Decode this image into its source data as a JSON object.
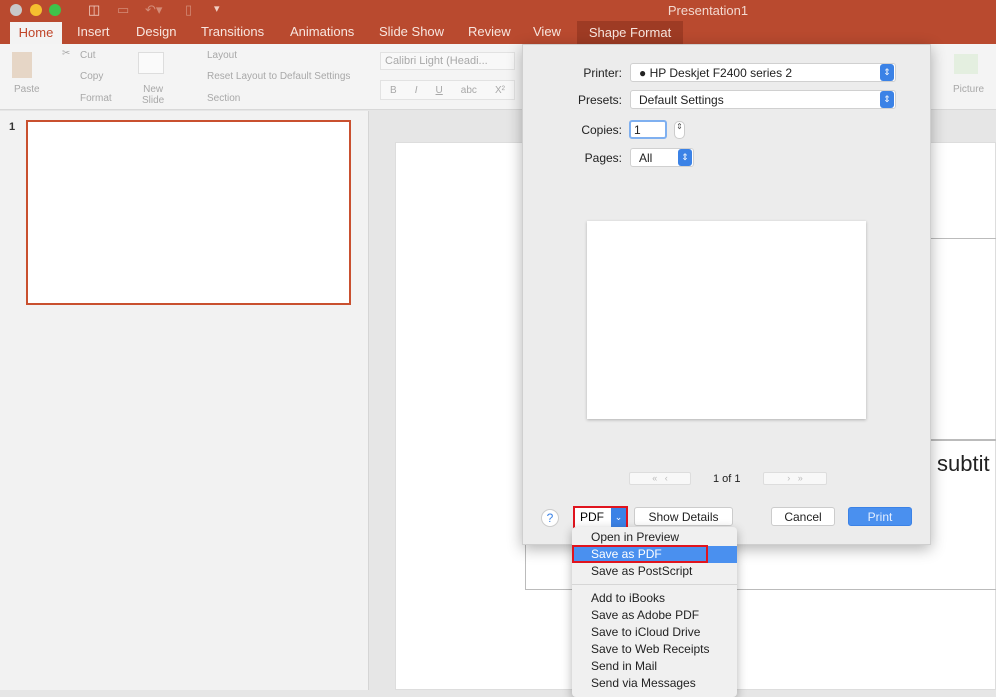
{
  "window": {
    "title": "Presentation1"
  },
  "tabs": [
    "Home",
    "Insert",
    "Design",
    "Transitions",
    "Animations",
    "Slide Show",
    "Review",
    "View",
    "Shape Format"
  ],
  "active_tab": "Home",
  "ribbon": {
    "paste": "Paste",
    "cut": "Cut",
    "copy": "Copy",
    "format": "Format",
    "new_slide": "New\nSlide",
    "layout": "Layout",
    "reset": "Reset Layout to Default Settings",
    "section": "Section",
    "font": "Calibri Light (Headi...",
    "bold": "B",
    "italic": "I",
    "underline": "U",
    "strike": "abc",
    "superscript": "X²",
    "picture": "Picture"
  },
  "slide_panel": {
    "number": "1"
  },
  "slide": {
    "subtitle_fragment": "subtit"
  },
  "print_dialog": {
    "printer_label": "Printer:",
    "printer": "HP Deskjet F2400 series 2",
    "presets_label": "Presets:",
    "presets": "Default Settings",
    "copies_label": "Copies:",
    "copies": "1",
    "pages_label": "Pages:",
    "pages": "All",
    "page_indicator": "1 of 1",
    "help": "?",
    "pdf": "PDF",
    "show_details": "Show Details",
    "cancel": "Cancel",
    "print": "Print",
    "accent": "#3b82e6"
  },
  "pdf_menu": {
    "items": [
      "Open in Preview",
      "Save as PDF",
      "Save as PostScript",
      "Add to iBooks",
      "Save as Adobe PDF",
      "Save to iCloud Drive",
      "Save to Web Receipts",
      "Send in Mail",
      "Send via Messages"
    ],
    "highlighted": "Save as PDF"
  }
}
